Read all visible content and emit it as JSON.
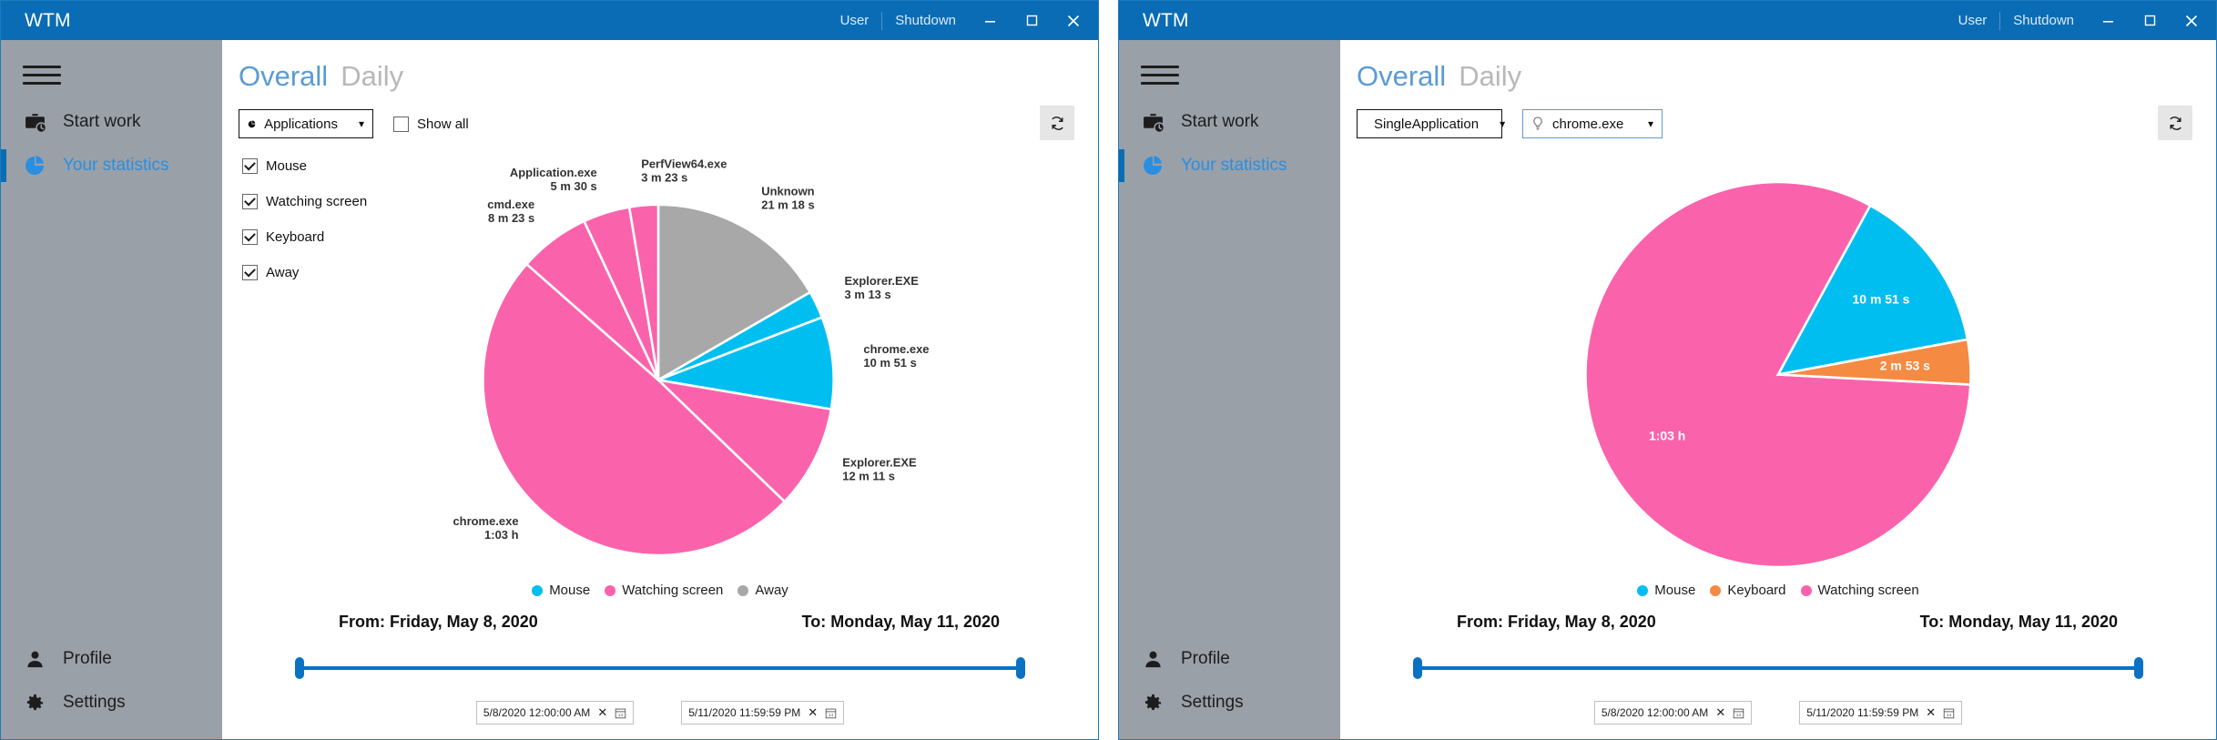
{
  "window": {
    "title": "WTM",
    "user_label": "User",
    "shutdown_label": "Shutdown",
    "minimize_icon": "minimize-icon",
    "maximize_icon": "maximize-icon",
    "close_icon": "close-icon",
    "accent_color": "#0a6cb4",
    "sidebar_color": "#9aa0a8"
  },
  "sidebar": {
    "menu_icon": "hamburger-icon",
    "items": [
      {
        "label": "Start work",
        "icon": "briefcase-clock-icon",
        "active": false
      },
      {
        "label": "Your statistics",
        "icon": "pie-chart-icon",
        "active": true
      }
    ],
    "bottom_items": [
      {
        "label": "Profile",
        "icon": "person-icon"
      },
      {
        "label": "Settings",
        "icon": "gear-icon"
      }
    ]
  },
  "header": {
    "tab_main": "Overall",
    "tab_sub": "Daily"
  },
  "left": {
    "visualization_select": {
      "value": "Applications",
      "icon": "pie-chart-icon"
    },
    "show_all": {
      "label": "Show all",
      "checked": false
    },
    "refresh_icon": "refresh-icon",
    "filters": [
      {
        "label": "Mouse",
        "checked": true
      },
      {
        "label": "Watching screen",
        "checked": true
      },
      {
        "label": "Keyboard",
        "checked": true
      },
      {
        "label": "Away",
        "checked": true
      }
    ],
    "legend": [
      {
        "label": "Mouse",
        "color": "#00BFF0"
      },
      {
        "label": "Watching screen",
        "color": "#FA63AC"
      },
      {
        "label": "Away",
        "color": "#A8A8A8"
      }
    ],
    "range": {
      "from_label": "From: Friday, May 8, 2020",
      "to_label": "To: Monday, May 11, 2020",
      "from_value": "5/8/2020 12:00:00 AM",
      "to_value": "5/11/2020 11:59:59 PM",
      "clear_icon": "close-icon",
      "calendar_icon": "calendar-icon"
    }
  },
  "right": {
    "visualization_select": {
      "value": "SingleApplication",
      "icon": "pie-chart-icon"
    },
    "application_select": {
      "value": "chrome.exe",
      "icon": "lightbulb-icon"
    },
    "refresh_icon": "refresh-icon",
    "legend": [
      {
        "label": "Mouse",
        "color": "#00BFF0"
      },
      {
        "label": "Keyboard",
        "color": "#F58A43"
      },
      {
        "label": "Watching screen",
        "color": "#FA63AC"
      }
    ],
    "range": {
      "from_label": "From: Friday, May 8, 2020",
      "to_label": "To: Monday, May 11, 2020",
      "from_value": "5/8/2020 12:00:00 AM",
      "to_value": "5/11/2020 11:59:59 PM",
      "clear_icon": "close-icon",
      "calendar_icon": "calendar-icon"
    }
  },
  "chart_data": [
    {
      "type": "pie",
      "title": "Overall time per application",
      "legend_position": "bottom",
      "slices": [
        {
          "label": "Unknown",
          "value_text": "21 m 18 s",
          "seconds": 1278,
          "color": "#A8A8A8",
          "category": "Away"
        },
        {
          "label": "Explorer.EXE",
          "value_text": "3 m 13 s",
          "seconds": 193,
          "color": "#00BFF0",
          "category": "Mouse"
        },
        {
          "label": "chrome.exe",
          "value_text": "10 m 51 s",
          "seconds": 651,
          "color": "#00BFF0",
          "category": "Mouse"
        },
        {
          "label": "Explorer.EXE",
          "value_text": "12 m 11 s",
          "seconds": 731,
          "color": "#FA63AC",
          "category": "Watching screen"
        },
        {
          "label": "chrome.exe",
          "value_text": "1:03 h",
          "seconds": 3780,
          "color": "#FA63AC",
          "category": "Watching screen"
        },
        {
          "label": "cmd.exe",
          "value_text": "8 m 23 s",
          "seconds": 503,
          "color": "#FA63AC",
          "category": "Watching screen"
        },
        {
          "label": "Application.exe",
          "value_text": "5 m 30 s",
          "seconds": 330,
          "color": "#FA63AC",
          "category": "Watching screen"
        },
        {
          "label": "PerfView64.exe",
          "value_text": "3 m 23 s",
          "seconds": 203,
          "color": "#FA63AC",
          "category": "Watching screen"
        }
      ]
    },
    {
      "type": "pie",
      "title": "chrome.exe time per activity",
      "legend_position": "bottom",
      "slices": [
        {
          "label": "Watching screen",
          "value_text": "1:03 h",
          "seconds": 3780,
          "color": "#FA63AC"
        },
        {
          "label": "Mouse",
          "value_text": "10 m 51 s",
          "seconds": 651,
          "color": "#00BFF0"
        },
        {
          "label": "Keyboard",
          "value_text": "2 m 53 s",
          "seconds": 173,
          "color": "#F58A43"
        }
      ]
    }
  ]
}
